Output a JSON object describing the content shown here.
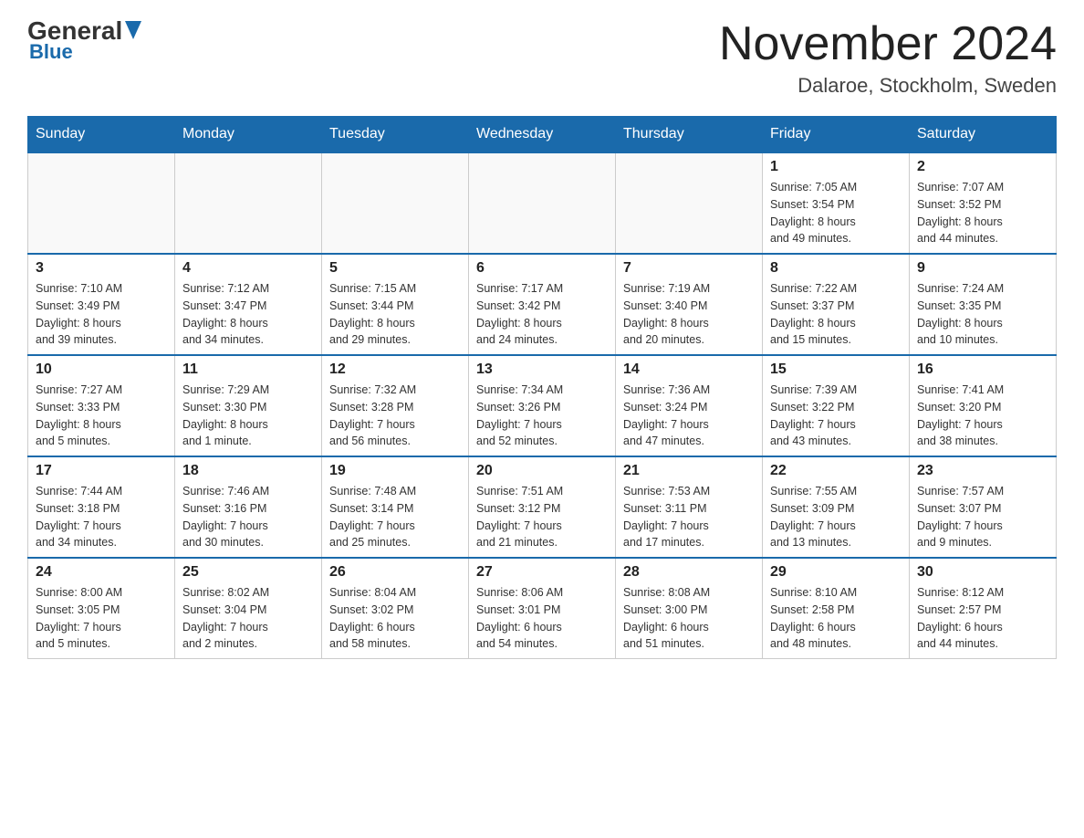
{
  "header": {
    "logo_general": "General",
    "logo_blue": "Blue",
    "month_title": "November 2024",
    "location": "Dalaroe, Stockholm, Sweden"
  },
  "days_of_week": [
    "Sunday",
    "Monday",
    "Tuesday",
    "Wednesday",
    "Thursday",
    "Friday",
    "Saturday"
  ],
  "weeks": [
    [
      {
        "day": "",
        "info": ""
      },
      {
        "day": "",
        "info": ""
      },
      {
        "day": "",
        "info": ""
      },
      {
        "day": "",
        "info": ""
      },
      {
        "day": "",
        "info": ""
      },
      {
        "day": "1",
        "info": "Sunrise: 7:05 AM\nSunset: 3:54 PM\nDaylight: 8 hours\nand 49 minutes."
      },
      {
        "day": "2",
        "info": "Sunrise: 7:07 AM\nSunset: 3:52 PM\nDaylight: 8 hours\nand 44 minutes."
      }
    ],
    [
      {
        "day": "3",
        "info": "Sunrise: 7:10 AM\nSunset: 3:49 PM\nDaylight: 8 hours\nand 39 minutes."
      },
      {
        "day": "4",
        "info": "Sunrise: 7:12 AM\nSunset: 3:47 PM\nDaylight: 8 hours\nand 34 minutes."
      },
      {
        "day": "5",
        "info": "Sunrise: 7:15 AM\nSunset: 3:44 PM\nDaylight: 8 hours\nand 29 minutes."
      },
      {
        "day": "6",
        "info": "Sunrise: 7:17 AM\nSunset: 3:42 PM\nDaylight: 8 hours\nand 24 minutes."
      },
      {
        "day": "7",
        "info": "Sunrise: 7:19 AM\nSunset: 3:40 PM\nDaylight: 8 hours\nand 20 minutes."
      },
      {
        "day": "8",
        "info": "Sunrise: 7:22 AM\nSunset: 3:37 PM\nDaylight: 8 hours\nand 15 minutes."
      },
      {
        "day": "9",
        "info": "Sunrise: 7:24 AM\nSunset: 3:35 PM\nDaylight: 8 hours\nand 10 minutes."
      }
    ],
    [
      {
        "day": "10",
        "info": "Sunrise: 7:27 AM\nSunset: 3:33 PM\nDaylight: 8 hours\nand 5 minutes."
      },
      {
        "day": "11",
        "info": "Sunrise: 7:29 AM\nSunset: 3:30 PM\nDaylight: 8 hours\nand 1 minute."
      },
      {
        "day": "12",
        "info": "Sunrise: 7:32 AM\nSunset: 3:28 PM\nDaylight: 7 hours\nand 56 minutes."
      },
      {
        "day": "13",
        "info": "Sunrise: 7:34 AM\nSunset: 3:26 PM\nDaylight: 7 hours\nand 52 minutes."
      },
      {
        "day": "14",
        "info": "Sunrise: 7:36 AM\nSunset: 3:24 PM\nDaylight: 7 hours\nand 47 minutes."
      },
      {
        "day": "15",
        "info": "Sunrise: 7:39 AM\nSunset: 3:22 PM\nDaylight: 7 hours\nand 43 minutes."
      },
      {
        "day": "16",
        "info": "Sunrise: 7:41 AM\nSunset: 3:20 PM\nDaylight: 7 hours\nand 38 minutes."
      }
    ],
    [
      {
        "day": "17",
        "info": "Sunrise: 7:44 AM\nSunset: 3:18 PM\nDaylight: 7 hours\nand 34 minutes."
      },
      {
        "day": "18",
        "info": "Sunrise: 7:46 AM\nSunset: 3:16 PM\nDaylight: 7 hours\nand 30 minutes."
      },
      {
        "day": "19",
        "info": "Sunrise: 7:48 AM\nSunset: 3:14 PM\nDaylight: 7 hours\nand 25 minutes."
      },
      {
        "day": "20",
        "info": "Sunrise: 7:51 AM\nSunset: 3:12 PM\nDaylight: 7 hours\nand 21 minutes."
      },
      {
        "day": "21",
        "info": "Sunrise: 7:53 AM\nSunset: 3:11 PM\nDaylight: 7 hours\nand 17 minutes."
      },
      {
        "day": "22",
        "info": "Sunrise: 7:55 AM\nSunset: 3:09 PM\nDaylight: 7 hours\nand 13 minutes."
      },
      {
        "day": "23",
        "info": "Sunrise: 7:57 AM\nSunset: 3:07 PM\nDaylight: 7 hours\nand 9 minutes."
      }
    ],
    [
      {
        "day": "24",
        "info": "Sunrise: 8:00 AM\nSunset: 3:05 PM\nDaylight: 7 hours\nand 5 minutes."
      },
      {
        "day": "25",
        "info": "Sunrise: 8:02 AM\nSunset: 3:04 PM\nDaylight: 7 hours\nand 2 minutes."
      },
      {
        "day": "26",
        "info": "Sunrise: 8:04 AM\nSunset: 3:02 PM\nDaylight: 6 hours\nand 58 minutes."
      },
      {
        "day": "27",
        "info": "Sunrise: 8:06 AM\nSunset: 3:01 PM\nDaylight: 6 hours\nand 54 minutes."
      },
      {
        "day": "28",
        "info": "Sunrise: 8:08 AM\nSunset: 3:00 PM\nDaylight: 6 hours\nand 51 minutes."
      },
      {
        "day": "29",
        "info": "Sunrise: 8:10 AM\nSunset: 2:58 PM\nDaylight: 6 hours\nand 48 minutes."
      },
      {
        "day": "30",
        "info": "Sunrise: 8:12 AM\nSunset: 2:57 PM\nDaylight: 6 hours\nand 44 minutes."
      }
    ]
  ]
}
